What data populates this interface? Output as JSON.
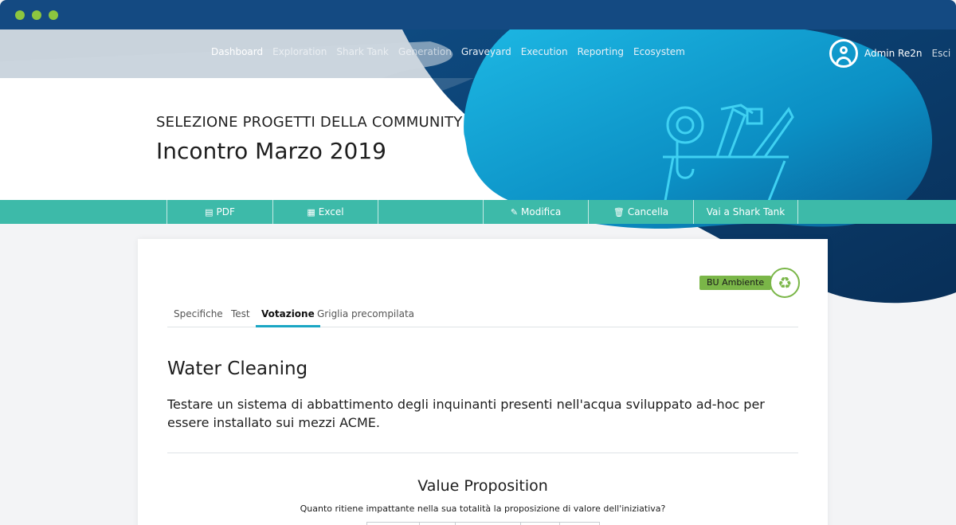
{
  "nav": {
    "items": [
      {
        "label": "Dashboard",
        "state": "active"
      },
      {
        "label": "Exploration",
        "state": "dim"
      },
      {
        "label": "Shark Tank",
        "state": "dim"
      },
      {
        "label": "Generation",
        "state": "dim"
      },
      {
        "label": "Graveyard",
        "state": "normal"
      },
      {
        "label": "Execution",
        "state": "normal"
      },
      {
        "label": "Reporting",
        "state": "normal"
      },
      {
        "label": "Ecosystem",
        "state": "normal"
      }
    ]
  },
  "user": {
    "name": "Admin Re2n",
    "logout": "Esci",
    "icon": "user-circle-icon"
  },
  "header": {
    "subtitle": "SELEZIONE PROGETTI DELLA COMMUNITY",
    "title": "Incontro Marzo 2019"
  },
  "toolbar": {
    "pdf": {
      "label": "PDF",
      "icon": "file-pdf-icon"
    },
    "excel": {
      "label": "Excel",
      "icon": "file-excel-icon"
    },
    "edit": {
      "label": "Modifica",
      "icon": "pencil-icon"
    },
    "delete": {
      "label": "Cancella",
      "icon": "trash-icon"
    },
    "shark": {
      "label": "Vai a Shark Tank"
    }
  },
  "badge": {
    "label": "BU Ambiente",
    "icon": "recycle-icon"
  },
  "tabs": [
    {
      "label": "Specifiche"
    },
    {
      "label": "Test"
    },
    {
      "label": "Votazione",
      "active": true
    },
    {
      "label": "Griglia precompilata"
    }
  ],
  "project": {
    "title": "Water Cleaning",
    "description": "Testare un sistema di abbattimento degli inquinanti presenti nell'acqua sviluppato ad-hoc per essere installato sui mezzi ACME."
  },
  "value_proposition": {
    "title": "Value Proposition",
    "question": "Quanto ritiene impattante nella sua totalità la proposizione di valore dell'iniziativa?"
  },
  "colors": {
    "window_bar": "#144a82",
    "toolbar": "#3dbaa9",
    "accent_tab": "#1aa6c4",
    "badge": "#7ab648",
    "blob_dark": "#0b3a6b",
    "blob_light": "#12a7d8"
  }
}
